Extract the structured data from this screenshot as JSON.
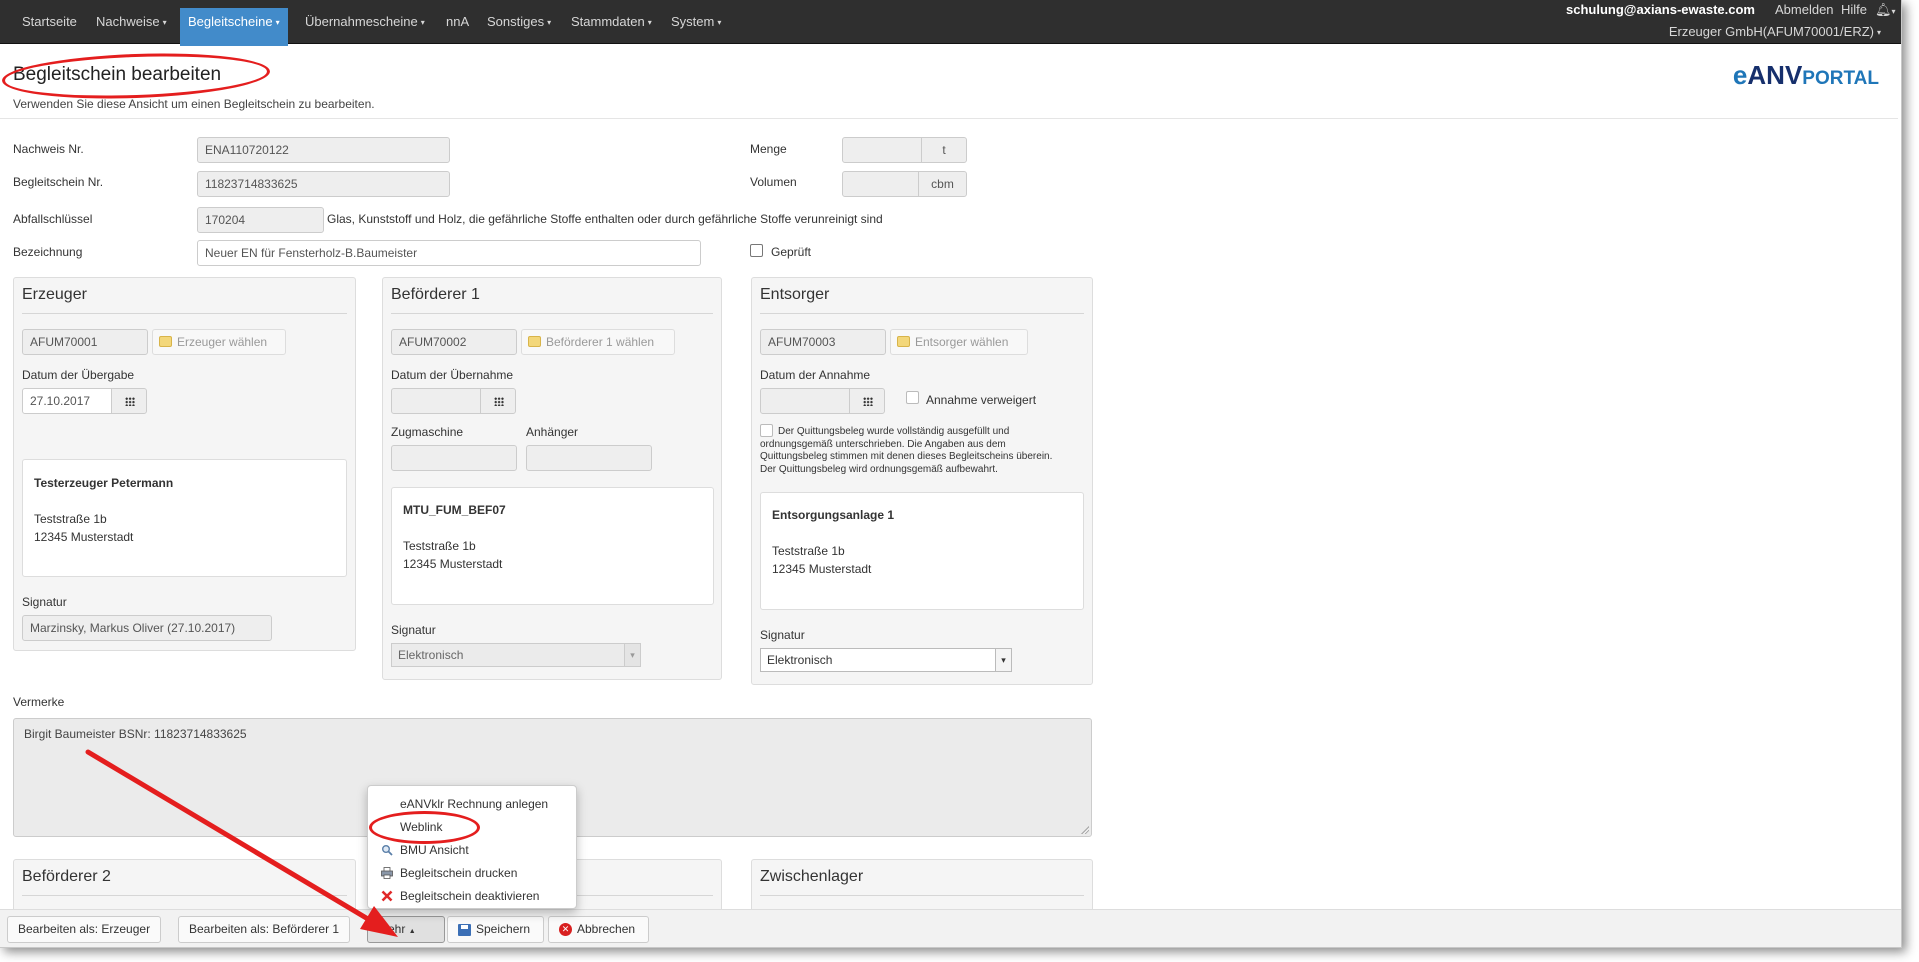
{
  "nav": {
    "items": [
      {
        "label": "Startseite",
        "caret": false
      },
      {
        "label": "Nachweise",
        "caret": true
      },
      {
        "label": "Begleitscheine",
        "caret": true,
        "active": true
      },
      {
        "label": "Übernahmescheine",
        "caret": true
      },
      {
        "label": "nnA",
        "caret": false
      },
      {
        "label": "Sonstiges",
        "caret": true
      },
      {
        "label": "Stammdaten",
        "caret": true
      },
      {
        "label": "System",
        "caret": true
      }
    ],
    "user": "schulung@axians-ewaste.com",
    "logout": "Abmelden",
    "help": "Hilfe",
    "org": "Erzeuger GmbH(AFUM70001/ERZ)",
    "bell_icon": "bell-icon"
  },
  "page": {
    "title": "Begleitschein bearbeiten",
    "subtitle": "Verwenden Sie diese Ansicht um einen Begleitschein zu bearbeiten.",
    "logo": {
      "e": "e",
      "anv": "ANV",
      "portal": "PORTAL"
    }
  },
  "form": {
    "nachweis_label": "Nachweis Nr.",
    "nachweis_value": "ENA110720122",
    "begleitschein_label": "Begleitschein Nr.",
    "begleitschein_value": "11823714833625",
    "abfall_label": "Abfallschlüssel",
    "abfall_value": "170204",
    "abfall_desc": "Glas, Kunststoff und Holz, die gefährliche Stoffe enthalten oder durch gefährliche Stoffe verunreinigt sind",
    "bezeichnung_label": "Bezeichnung",
    "bezeichnung_value": "Neuer EN für Fensterholz-B.Baumeister",
    "menge_label": "Menge",
    "menge_unit": "t",
    "volumen_label": "Volumen",
    "volumen_unit": "cbm",
    "geprueft_label": "Geprüft"
  },
  "erzeuger": {
    "title": "Erzeuger",
    "id": "AFUM70001",
    "pick_label": "Erzeuger wählen",
    "date_label": "Datum der Übergabe",
    "date_value": "27.10.2017",
    "addr_name": "Testerzeuger Petermann",
    "addr_street": "Teststraße 1b",
    "addr_city": "12345 Musterstadt",
    "sig_label": "Signatur",
    "sig_value": "Marzinsky, Markus Oliver (27.10.2017)"
  },
  "befoerderer1": {
    "title": "Beförderer 1",
    "id": "AFUM70002",
    "pick_label": "Beförderer 1 wählen",
    "date_label": "Datum der Übernahme",
    "zug_label": "Zugmaschine",
    "anh_label": "Anhänger",
    "addr_name": "MTU_FUM_BEF07",
    "addr_street": "Teststraße 1b",
    "addr_city": "12345 Musterstadt",
    "sig_label": "Signatur",
    "sig_value": "Elektronisch"
  },
  "entsorger": {
    "title": "Entsorger",
    "id": "AFUM70003",
    "pick_label": "Entsorger wählen",
    "date_label": "Datum der Annahme",
    "refused_label": "Annahme verweigert",
    "receipt_lines": [
      "Der Quittungsbeleg wurde vollständig ausgefüllt und",
      "ordnungsgemäß unterschrieben. Die Angaben aus dem",
      "Quittungsbeleg stimmen mit denen dieses Begleitscheins überein.",
      "Der Quittungsbeleg wird ordnungsgemäß aufbewahrt."
    ],
    "addr_name": "Entsorgungsanlage 1",
    "addr_street": "Teststraße 1b",
    "addr_city": "12345 Musterstadt",
    "sig_label": "Signatur",
    "sig_value": "Elektronisch"
  },
  "vermerke": {
    "label": "Vermerke",
    "value": "Birgit Baumeister BSNr: 11823714833625"
  },
  "lower_panels": {
    "befoerderer2": "Beförderer 2",
    "zwischenlager": "Zwischenlager"
  },
  "menu": {
    "items": [
      {
        "label": "eANVklr Rechnung anlegen",
        "icon": ""
      },
      {
        "label": "Weblink",
        "icon": ""
      },
      {
        "label": "BMU Ansicht",
        "icon": "magnifier-icon"
      },
      {
        "label": "Begleitschein drucken",
        "icon": "printer-icon"
      },
      {
        "label": "Begleitschein deaktivieren",
        "icon": "red-x-icon"
      }
    ]
  },
  "toolbar": {
    "edit_erzeuger": "Bearbeiten als: Erzeuger",
    "edit_befoerderer": "Bearbeiten als: Beförderer 1",
    "more": "Mehr",
    "save": "Speichern",
    "cancel": "Abbrechen"
  },
  "colors": {
    "navbar": "#2f2f2f",
    "nav_active": "#428bca",
    "annotation_red": "#e41e1e",
    "logo_blue": "#1f76b8",
    "logo_dark": "#162f6c"
  }
}
